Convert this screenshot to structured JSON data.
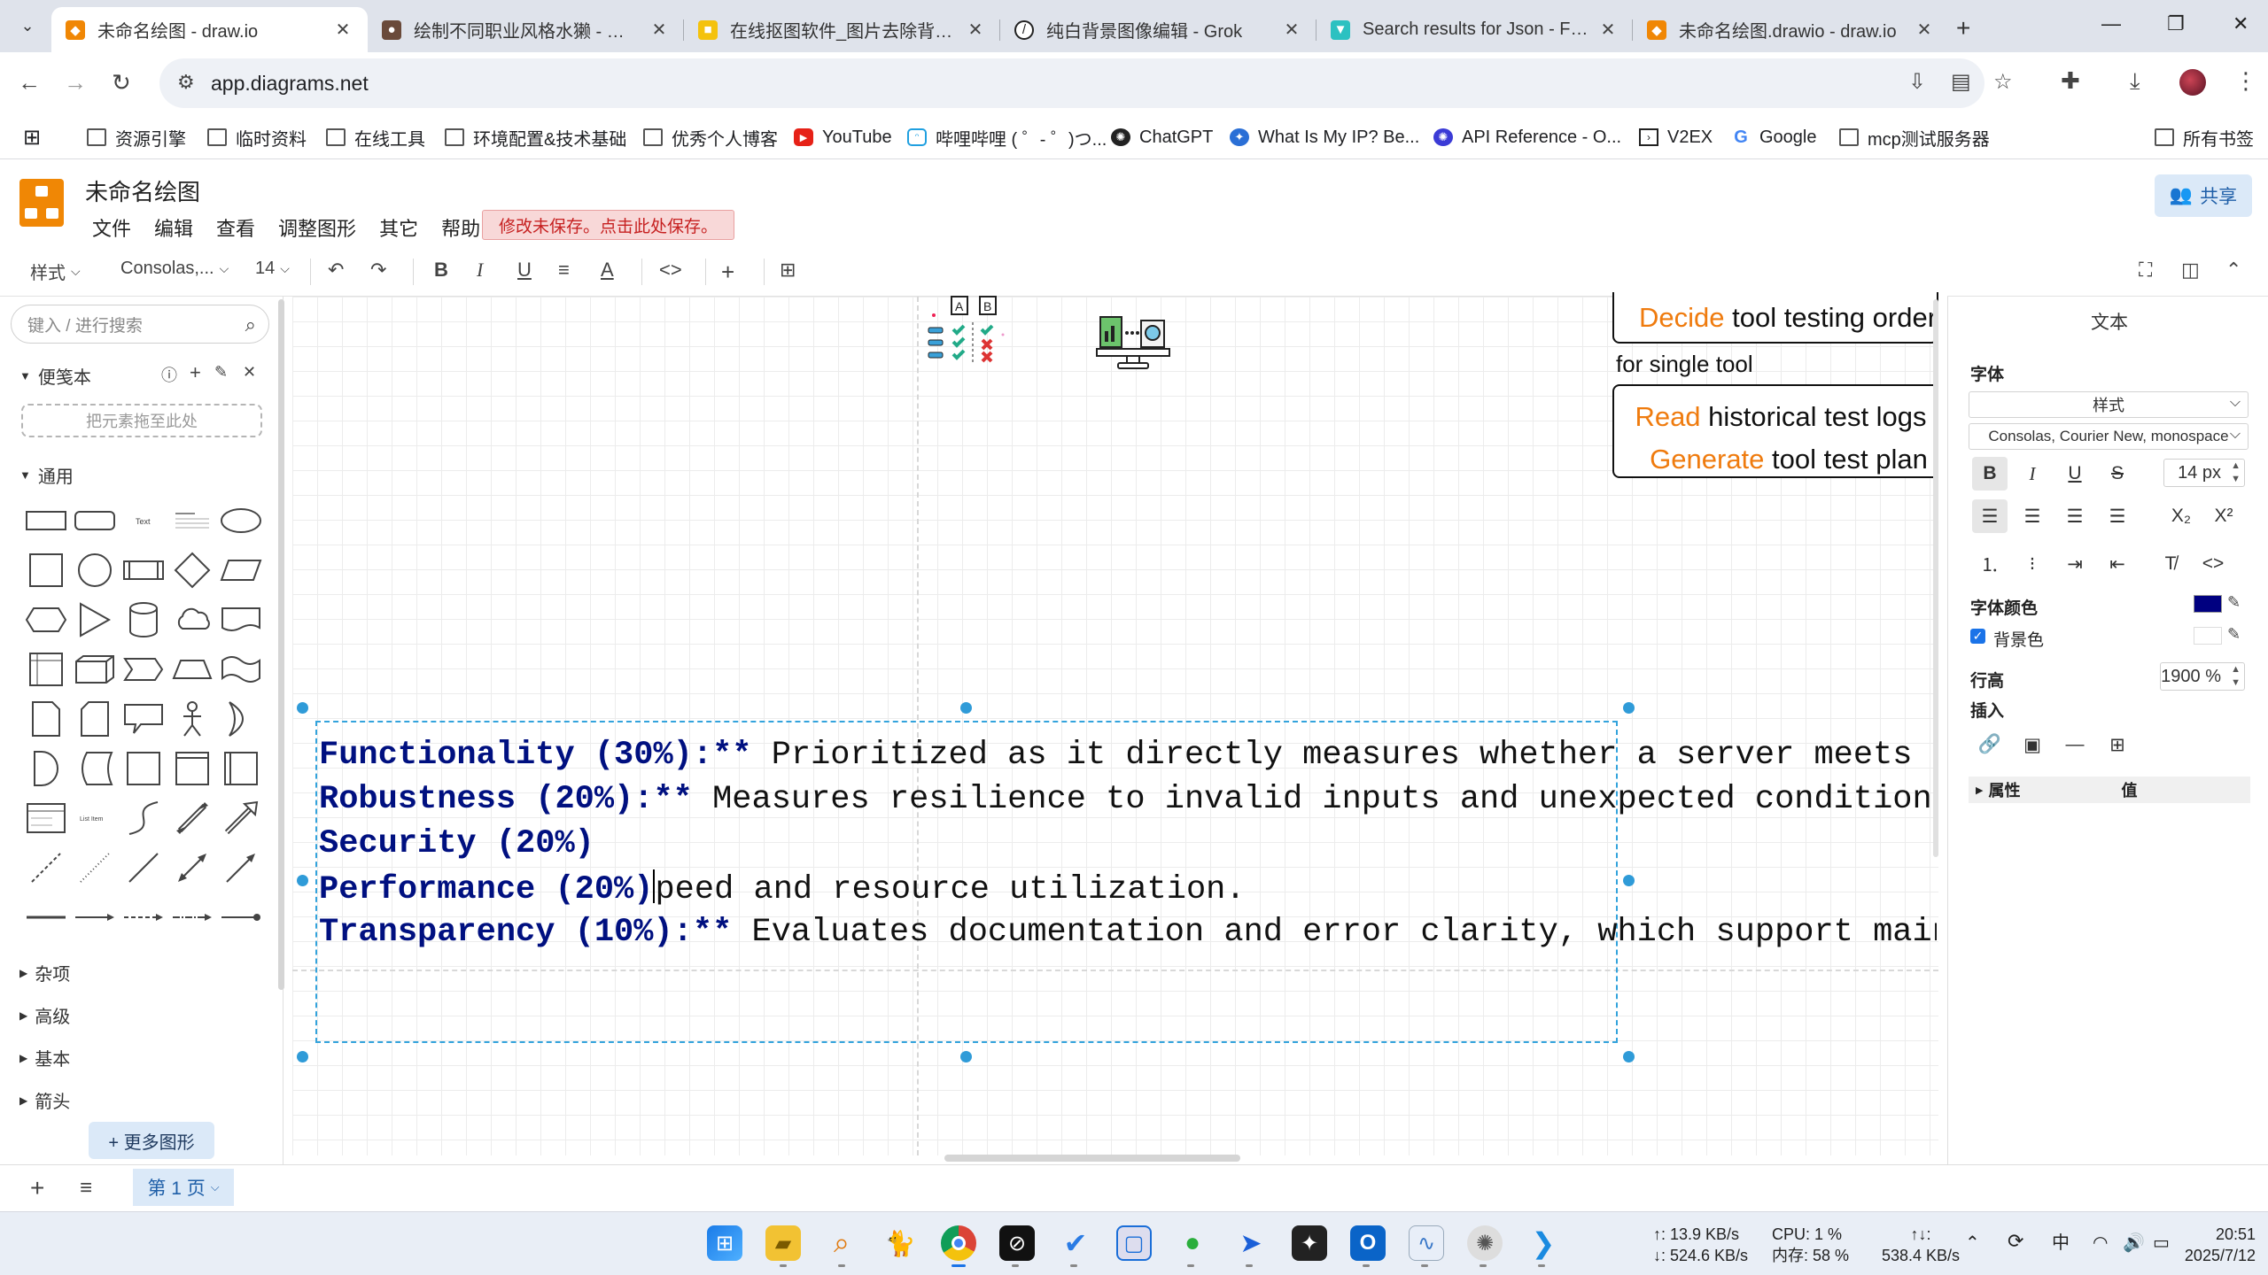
{
  "browser": {
    "tabs": [
      {
        "title": "未命名绘图 - draw.io",
        "active": true,
        "icon": "drawio-icon",
        "color": "#f08705"
      },
      {
        "title": "绘制不同职业风格水獭 - 豆包",
        "active": false,
        "icon": "doubao-icon",
        "color": "#6a4a3a"
      },
      {
        "title": "在线抠图软件_图片去除背景 | r",
        "active": false,
        "icon": "remove-bg-icon",
        "color": "#f4c20d"
      },
      {
        "title": "纯白背景图像编辑 - Grok",
        "active": false,
        "icon": "grok-icon",
        "color": "#222222"
      },
      {
        "title": "Search results for Json - Flati",
        "active": false,
        "icon": "flaticon-icon",
        "color": "#2cc1c1"
      },
      {
        "title": "未命名绘图.drawio - draw.io",
        "active": false,
        "icon": "drawio-icon",
        "color": "#f08705"
      }
    ],
    "url": "app.diagrams.net",
    "bookmarks": [
      {
        "label": "资源引擎",
        "icon": "folder-icon"
      },
      {
        "label": "临时资料",
        "icon": "folder-icon"
      },
      {
        "label": "在线工具",
        "icon": "folder-icon"
      },
      {
        "label": "环境配置&技术基础",
        "icon": "folder-icon"
      },
      {
        "label": "优秀个人博客",
        "icon": "folder-icon"
      },
      {
        "label": "YouTube",
        "icon": "youtube-icon"
      },
      {
        "label": "哔哩哔哩 ( ゜- ゜)つ...",
        "icon": "bilibili-icon"
      },
      {
        "label": "ChatGPT",
        "icon": "chatgpt-icon"
      },
      {
        "label": "What Is My IP? Be...",
        "icon": "globe-icon"
      },
      {
        "label": "API Reference - O...",
        "icon": "openai-icon"
      },
      {
        "label": "V2EX",
        "icon": "v2ex-icon"
      },
      {
        "label": "Google",
        "icon": "google-icon"
      },
      {
        "label": "mcp测试服务器",
        "icon": "folder-icon"
      }
    ],
    "all_bookmarks": "所有书签"
  },
  "app": {
    "doc_title": "未命名绘图",
    "menu": [
      "文件",
      "编辑",
      "查看",
      "调整图形",
      "其它",
      "帮助"
    ],
    "unsaved_notice": "修改未保存。点击此处保存。",
    "share_label": "共享",
    "toolbar": {
      "style": "样式",
      "font": "Consolas,...",
      "size": "14"
    }
  },
  "left_panel": {
    "search_placeholder": "键入 / 进行搜索",
    "scratchpad": "便笺本",
    "dropzone": "把元素拖至此处",
    "general": "通用",
    "sections": [
      "杂项",
      "高级",
      "基本",
      "箭头"
    ],
    "more_shapes": "+ 更多图形"
  },
  "canvas": {
    "box1": {
      "part1": "Decide",
      "part2": " tool testing order"
    },
    "caption": "for single tool",
    "box2": {
      "line1a": "Read",
      "line1b": " historical test logs",
      "line2a": "Generate",
      "line2b": " tool test plan"
    },
    "lines": [
      {
        "bold": "Functionality (30%):**",
        "rest": " Prioritized as it directly measures whether a server meets its core"
      },
      {
        "bold": "Robustness (20%):**",
        "rest": " Measures resilience to invalid inputs and unexpected conditions, which"
      },
      {
        "bold": "Security (20%)",
        "rest": ""
      },
      {
        "bold": "Performance (20%)",
        "rest": "peed and resource utilization."
      },
      {
        "bold": "Transparency (10%):**",
        "rest": " Evaluates documentation and error clarity, which support maintainabil"
      }
    ]
  },
  "right_panel": {
    "tab": "文本",
    "font_section": "字体",
    "style_select": "样式",
    "font_family": "Consolas, Courier New, monospace",
    "font_size": "14 px",
    "font_color_label": "字体颜色",
    "font_color": "#000080",
    "bg_color_label": "背景色",
    "line_height_label": "行高",
    "line_height": "1900 %",
    "insert_label": "插入",
    "props": {
      "name": "属性",
      "value": "值"
    }
  },
  "pages": {
    "current": "第 1 页"
  },
  "taskbar": {
    "net_up": "↑: 13.9 KB/s",
    "net_down": "↓: 524.6 KB/s",
    "cpu": "CPU: 1 %",
    "mem": "内存: 58 %",
    "total_label": "↑↓:",
    "total": "538.4 KB/s",
    "ime": "中",
    "time": "20:51",
    "date": "2025/7/12"
  }
}
